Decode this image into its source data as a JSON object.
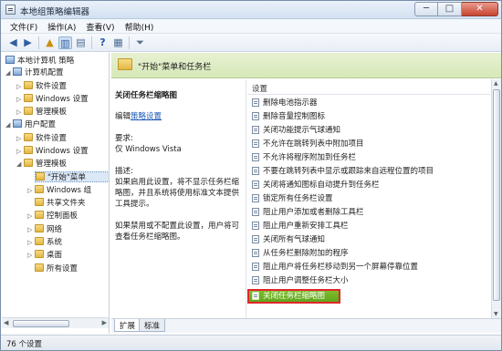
{
  "window": {
    "title": "本地组策略编辑器"
  },
  "window_buttons": {
    "minimize": "─",
    "maximize": "□",
    "close": "✕"
  },
  "menu": [
    "文件(F)",
    "操作(A)",
    "查看(V)",
    "帮助(H)"
  ],
  "tree": {
    "root": "本地计算机 策略",
    "computer_config": "计算机配置",
    "computer_software": "软件设置",
    "computer_windows": "Windows 设置",
    "computer_admin": "管理模板",
    "user_config": "用户配置",
    "user_software": "软件设置",
    "user_windows": "Windows 设置",
    "user_admin": "管理模板",
    "start_menu": "\"开始\"菜单",
    "windows_components": "Windows 组",
    "shared_folders": "共享文件夹",
    "control_panel": "控制面板",
    "network": "网络",
    "system": "系统",
    "desktop": "桌面",
    "all_settings": "所有设置"
  },
  "header": {
    "title": "\"开始\"菜单和任务栏"
  },
  "description": {
    "title": "关闭任务栏缩略图",
    "edit_prefix": "编辑",
    "edit_link": "策略设置",
    "req_label": "要求:",
    "req_value": "仅 Windows Vista",
    "desc_label": "描述:",
    "desc_text": "如果启用此设置，将不显示任务栏缩略图，并且系统将使用标准文本提供工具提示。",
    "desc_text2": "如果禁用或不配置此设置，用户将可查看任务栏缩略图。"
  },
  "list": {
    "header": "设置",
    "items": [
      "删除电池指示器",
      "删除音量控制图标",
      "关闭功能提示气球通知",
      "不允许在跳转列表中附加项目",
      "不允许将程序附加到任务栏",
      "不要在跳转列表中显示或跟踪来自远程位置的项目",
      "关闭将通知图标自动提升到任务栏",
      "锁定所有任务栏设置",
      "阻止用户添加或者删除工具栏",
      "阻止用户重新安排工具栏",
      "关闭所有气球通知",
      "从任务栏删除附加的程序",
      "阻止用户将任务栏移动到另一个屏幕停靠位置",
      "阻止用户调整任务栏大小",
      "关闭任务栏缩略图"
    ],
    "selected_index": 14
  },
  "tabs": [
    "扩展",
    "标准"
  ],
  "status": {
    "text": "76 个设置"
  }
}
